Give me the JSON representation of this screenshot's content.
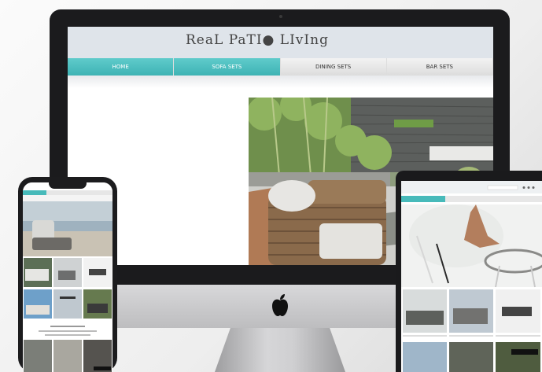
{
  "site": {
    "logo": "ReaL PaTI● LIvIng"
  },
  "nav": [
    {
      "label": "HOME",
      "active": true
    },
    {
      "label": "SOFA SETS",
      "active": true
    },
    {
      "label": "DINING SETS",
      "active": false
    },
    {
      "label": "BAR SETS",
      "active": false
    }
  ],
  "colors": {
    "accent": "#47baba",
    "bezel": "#1b1b1d",
    "header_bg": "#dfe4ea"
  },
  "icons": [
    "apple-logo-icon"
  ]
}
